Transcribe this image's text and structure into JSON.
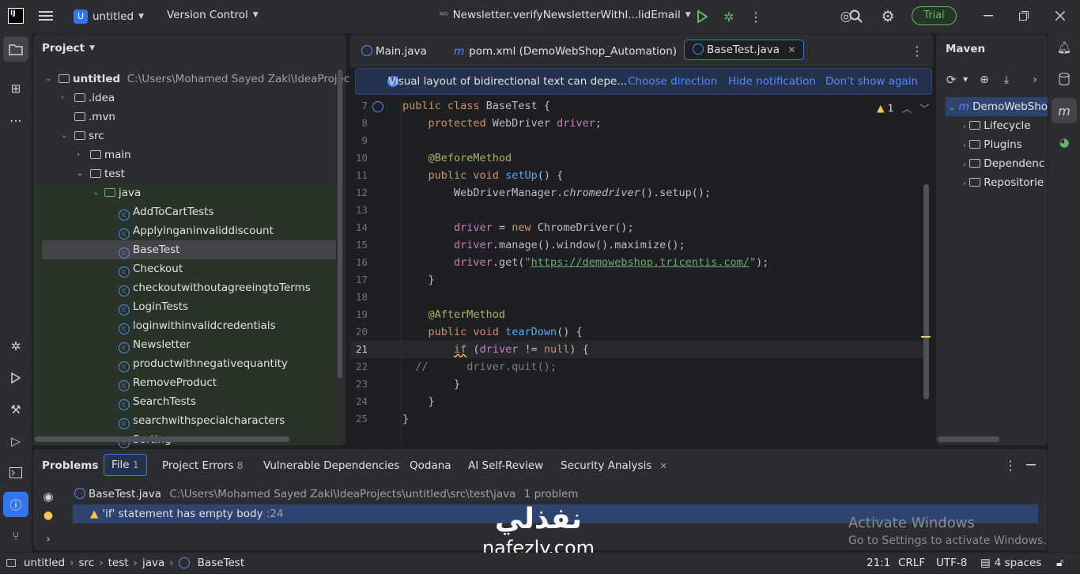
{
  "titlebar": {
    "logo": "IJ",
    "project_badge": "U",
    "project_name": "untitled",
    "vcs": "Version Control",
    "run_config": "Newsletter.verifyNewsletterWithI...lidEmail",
    "trial": "Trial"
  },
  "project_panel": {
    "title": "Project",
    "root": {
      "name": "untitled",
      "path": "C:\\Users\\Mohamed Sayed Zaki\\IdeaProjects\\ur"
    },
    "items": [
      ".idea",
      ".mvn",
      "src",
      "main",
      "test",
      "java"
    ],
    "classes": [
      "AddToCartTests",
      "Applyinganinvaliddiscount",
      "BaseTest",
      "Checkout",
      "checkoutwithoutagreeingtoTerms",
      "LoginTests",
      "loginwithinvalidcredentials",
      "Newsletter",
      "productwithnegativequantity",
      "RemoveProduct",
      "SearchTests",
      "searchwithspecialcharacters",
      "Sorting"
    ]
  },
  "editor": {
    "tabs": [
      "Main.java",
      "pom.xml (DemoWebShop_Automation)",
      "BaseTest.java"
    ],
    "notification": {
      "text": "Visual layout of bidirectional text can depe...",
      "choose": "Choose direction",
      "hide": "Hide notification",
      "dont": "Don't show again"
    },
    "warning_count": "1",
    "line_numbers": [
      "7",
      "8",
      "9",
      "10",
      "11",
      "12",
      "13",
      "14",
      "15",
      "16",
      "17",
      "18",
      "19",
      "20",
      "21",
      "22",
      "23",
      "24",
      "25"
    ]
  },
  "maven": {
    "title": "Maven",
    "root": "DemoWebShop",
    "items": [
      "Lifecycle",
      "Plugins",
      "Dependenc",
      "Repositorie"
    ]
  },
  "problems": {
    "title": "Problems",
    "tabs": [
      {
        "label": "File",
        "count": "1"
      },
      {
        "label": "Project Errors",
        "count": "8"
      },
      {
        "label": "Vulnerable Dependencies",
        "count": ""
      },
      {
        "label": "Qodana",
        "count": ""
      },
      {
        "label": "AI Self-Review",
        "count": ""
      },
      {
        "label": "Security Analysis",
        "count": ""
      }
    ],
    "file_row": {
      "name": "BaseTest.java",
      "path": "C:\\Users\\Mohamed Sayed Zaki\\IdeaProjects\\untitled\\src\\test\\java",
      "summary": "1 problem"
    },
    "issue": {
      "text": "'if' statement has empty body",
      "line": ":24"
    }
  },
  "watermark": {
    "activate_title": "Activate Windows",
    "activate_sub": "Go to Settings to activate Windows.",
    "brand_ar": "نفذلي",
    "brand_en": "nafezly.com"
  },
  "statusbar": {
    "crumbs": [
      "untitled",
      "src",
      "test",
      "java",
      "BaseTest"
    ],
    "position": "21:1",
    "line_sep": "CRLF",
    "encoding": "UTF-8",
    "indent": "4 spaces"
  },
  "colors": {
    "accent": "#548af7",
    "trial": "#5fb865",
    "warning": "#f2c55c"
  }
}
